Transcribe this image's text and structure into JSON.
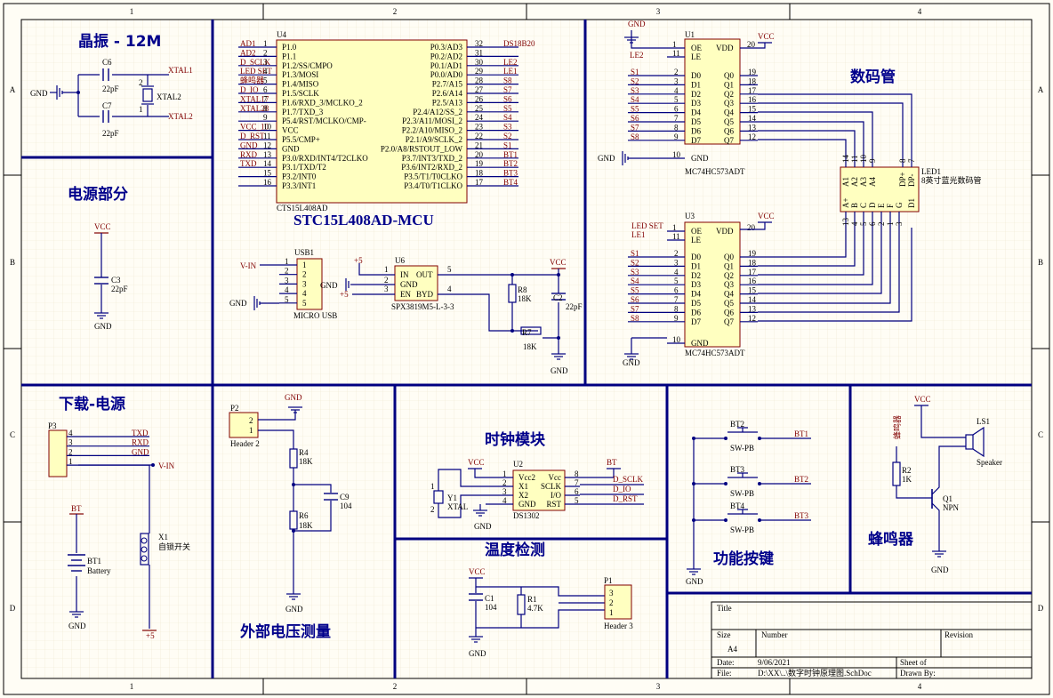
{
  "border": {
    "cols": [
      "1",
      "2",
      "3",
      "4"
    ],
    "rows": [
      "A",
      "B",
      "C",
      "D"
    ]
  },
  "sections": {
    "crystal": "晶振 - 12M",
    "power": "电源部分",
    "download": "下载-电源",
    "voltage": "外部电压测量",
    "clock": "时钟模块",
    "temp": "温度检测",
    "keys": "功能按键",
    "buzzer": "蜂鸣器",
    "display": "数码管"
  },
  "mcu": {
    "ref": "U4",
    "part": "CTS15L408AD",
    "title": "STC15L408AD-MCU",
    "left_pins": [
      {
        "net": "AD1",
        "num": "1",
        "name": "P1.0"
      },
      {
        "net": "AD2",
        "num": "2",
        "name": "P1.1"
      },
      {
        "net": "D_SCLK",
        "num": "3",
        "name": "P1.2/SS/CMPO"
      },
      {
        "net": "LED SET",
        "num": "4",
        "name": "P1.3/MOSI"
      },
      {
        "net": "蜂鸣器",
        "num": "5",
        "name": "P1.4/MISO"
      },
      {
        "net": "D_IO",
        "num": "6",
        "name": "P1.5/SCLK"
      },
      {
        "net": "XTAL17",
        "num": "7",
        "name": "P1.6/RXD_3/MCLKO_2"
      },
      {
        "net": "XTAL28",
        "num": "8",
        "name": "P1.7/TXD_3"
      },
      {
        "net": "",
        "num": "9",
        "name": "P5.4/RST/MCLKO/CMP-"
      },
      {
        "net": "VCC_10",
        "num": "10",
        "name": "VCC"
      },
      {
        "net": "D_RST",
        "num": "11",
        "name": "P5.5/CMP+"
      },
      {
        "net": "GND",
        "num": "12",
        "name": "GND"
      },
      {
        "net": "RXD",
        "num": "13",
        "name": "P3.0/RXD/INT4/T2CLKO"
      },
      {
        "net": "TXD",
        "num": "14",
        "name": "P3.1/TXD/T2"
      },
      {
        "net": "",
        "num": "15",
        "name": "P3.2/INT0"
      },
      {
        "net": "",
        "num": "16",
        "name": "P3.3/INT1"
      }
    ],
    "right_pins": [
      {
        "net": "DS18B20",
        "num": "32",
        "name": "P0.3/AD3"
      },
      {
        "net": "",
        "num": "31",
        "name": "P0.2/AD2"
      },
      {
        "net": "LE2",
        "num": "30",
        "name": "P0.1/AD1"
      },
      {
        "net": "LE1",
        "num": "29",
        "name": "P0.0/AD0"
      },
      {
        "net": "S8",
        "num": "28",
        "name": "P2.7/A15"
      },
      {
        "net": "S7",
        "num": "27",
        "name": "P2.6/A14"
      },
      {
        "net": "S6",
        "num": "26",
        "name": "P2.5/A13"
      },
      {
        "net": "S5",
        "num": "25",
        "name": "P2.4/A12/SS_2"
      },
      {
        "net": "S4",
        "num": "24",
        "name": "P2.3/A11/MOSI_2"
      },
      {
        "net": "S3",
        "num": "23",
        "name": "P2.2/A10/MISO_2"
      },
      {
        "net": "S2",
        "num": "22",
        "name": "P2.1/A9/SCLK_2"
      },
      {
        "net": "S1",
        "num": "21",
        "name": "P2.0/A8/RSTOUT_LOW"
      },
      {
        "net": "BT1",
        "num": "20",
        "name": "P3.7/INT3/TXD_2"
      },
      {
        "net": "BT2",
        "num": "19",
        "name": "P3.6/INT2/RXD_2"
      },
      {
        "net": "BT3",
        "num": "18",
        "name": "P3.5/T1/T0CLKO"
      },
      {
        "net": "BT4",
        "num": "17",
        "name": "P3.4/T0/T1CLKO"
      }
    ]
  },
  "crystal": {
    "c6": "C6",
    "c6v": "22pF",
    "c7": "C7",
    "c7v": "22pF",
    "xtal": "XTAL2",
    "gnd": "GND",
    "net1": "XTAL1",
    "net2": "XTAL2",
    "p1": "1",
    "p2": "2"
  },
  "power": {
    "vcc": "VCC",
    "ref": "C3",
    "val": "22pF",
    "gnd": "GND"
  },
  "usb": {
    "ref": "USB1",
    "part": "MICRO USB",
    "vin": "V-IN",
    "gnd": "GND",
    "pins": [
      "1",
      "2",
      "3",
      "4",
      "5"
    ]
  },
  "ldo": {
    "ref": "U6",
    "part": "SPX3819M5-L-3-3",
    "pins": [
      {
        "num": "1",
        "name": "IN"
      },
      {
        "num": "2",
        "name": "GND"
      },
      {
        "num": "3",
        "name": "EN"
      }
    ],
    "rpins": [
      {
        "num": "5",
        "name": "OUT"
      },
      {
        "num": "4",
        "name": "BYD"
      }
    ],
    "v5": "+5",
    "gnd": "GND",
    "v5b": "+5",
    "vcc": "VCC",
    "r8": "R8",
    "r8v": "18K",
    "r7": "R7",
    "r7v": "18K",
    "c2": "C2",
    "c2v": "22pF",
    "gnd2": "GND"
  },
  "latch1": {
    "ref": "U1",
    "part": "MC74HC573ADT",
    "gnd": "GND",
    "vcc": "VCC",
    "le": "LE2",
    "gnd2": "GND",
    "oe": {
      "num": "1",
      "name": "OE"
    },
    "lep": {
      "num": "11",
      "name": "LE"
    },
    "vdd": {
      "num": "20",
      "name": "VDD"
    },
    "gndp": {
      "num": "10",
      "name": "GND"
    },
    "d": [
      {
        "net": "S1",
        "num": "2",
        "name": "D0"
      },
      {
        "net": "S2",
        "num": "3",
        "name": "D1"
      },
      {
        "net": "S3",
        "num": "4",
        "name": "D2"
      },
      {
        "net": "S4",
        "num": "5",
        "name": "D3"
      },
      {
        "net": "S5",
        "num": "6",
        "name": "D4"
      },
      {
        "net": "S6",
        "num": "7",
        "name": "D5"
      },
      {
        "net": "S7",
        "num": "8",
        "name": "D6"
      },
      {
        "net": "S8",
        "num": "9",
        "name": "D7"
      }
    ],
    "q": [
      {
        "num": "19",
        "name": "Q0"
      },
      {
        "num": "18",
        "name": "Q1"
      },
      {
        "num": "17",
        "name": "Q2"
      },
      {
        "num": "16",
        "name": "Q3"
      },
      {
        "num": "15",
        "name": "Q4"
      },
      {
        "num": "14",
        "name": "Q5"
      },
      {
        "num": "13",
        "name": "Q6"
      },
      {
        "num": "12",
        "name": "Q7"
      }
    ]
  },
  "latch2": {
    "ref": "U3",
    "part": "MC74HC573ADT",
    "vcc": "VCC",
    "gnd": "GND",
    "ledset": "LED SET",
    "le": "LE1",
    "oe": {
      "num": "1",
      "name": "OE"
    },
    "lep": {
      "num": "11",
      "name": "LE"
    },
    "vdd": {
      "num": "20",
      "name": "VDD"
    },
    "gndp": {
      "num": "10",
      "name": "GND"
    },
    "d": [
      {
        "net": "S1",
        "num": "2",
        "name": "D0"
      },
      {
        "net": "S2",
        "num": "3",
        "name": "D1"
      },
      {
        "net": "S3",
        "num": "4",
        "name": "D2"
      },
      {
        "net": "S4",
        "num": "5",
        "name": "D3"
      },
      {
        "net": "S5",
        "num": "6",
        "name": "D4"
      },
      {
        "net": "S6",
        "num": "7",
        "name": "D5"
      },
      {
        "net": "S7",
        "num": "8",
        "name": "D6"
      },
      {
        "net": "S8",
        "num": "9",
        "name": "D7"
      }
    ],
    "q": [
      {
        "num": "19",
        "name": "Q0"
      },
      {
        "num": "18",
        "name": "Q1"
      },
      {
        "num": "17",
        "name": "Q2"
      },
      {
        "num": "16",
        "name": "Q3"
      },
      {
        "num": "15",
        "name": "Q4"
      },
      {
        "num": "14",
        "name": "Q5"
      },
      {
        "num": "13",
        "name": "Q6"
      },
      {
        "num": "12",
        "name": "Q7"
      }
    ]
  },
  "led": {
    "ref": "LED1",
    "part": "8英寸蓝光数码管",
    "top_nums": [
      "14",
      "11",
      "10",
      "9",
      "8",
      "7"
    ],
    "top_names": [
      "A1",
      "A2",
      "A3",
      "A4",
      "DP+",
      "DP-"
    ],
    "bottom_nums": [
      "13",
      "4",
      "5",
      "6",
      "2",
      "1",
      "3"
    ],
    "bottom_names": [
      "A+",
      "B",
      "C",
      "D",
      "E",
      "F",
      "G",
      "D1"
    ]
  },
  "download": {
    "ref": "P3",
    "nets": [
      "TXD",
      "RXD",
      "GND",
      ""
    ],
    "pins": [
      "4",
      "3",
      "2",
      "1"
    ],
    "vin": "V-IN",
    "bt": "BT",
    "bt1": "BT1",
    "bt1v": "Battery",
    "x1": "X1",
    "x1v": "自锁开关",
    "gnd": "GND",
    "v5": "+5"
  },
  "voltage": {
    "ref": "P2",
    "part": "Header 2",
    "pins": [
      "2",
      "1"
    ],
    "gnd": "GND",
    "r4": "R4",
    "r4v": "18K",
    "r6": "R6",
    "r6v": "18K",
    "c9": "C9",
    "c9v": "104",
    "gnd2": "GND"
  },
  "clock": {
    "ref": "U2",
    "part": "DS1302",
    "vcc": "VCC",
    "bt": "BT",
    "y1": "Y1",
    "y1v": "XTAL",
    "gnd": "GND",
    "lpins": [
      {
        "num": "1",
        "name": "Vcc2"
      },
      {
        "num": "2",
        "name": "X1"
      },
      {
        "num": "3",
        "name": "X2"
      },
      {
        "num": "4",
        "name": "GND"
      }
    ],
    "rpins": [
      {
        "num": "8",
        "name": "Vcc"
      },
      {
        "num": "7",
        "name": "SCLK"
      },
      {
        "num": "6",
        "name": "I/O"
      },
      {
        "num": "5",
        "name": "RST"
      }
    ],
    "nets": [
      "D_SCLK",
      "D_IO",
      "D_RST"
    ],
    "yp": [
      "1",
      "2"
    ]
  },
  "temp": {
    "vcc": "VCC",
    "c1": "C1",
    "c1v": "104",
    "r1": "R1",
    "r1v": "4.7K",
    "p1": "P1",
    "part": "Header 3",
    "pins": [
      "3",
      "2",
      "1"
    ],
    "gnd": "GND"
  },
  "keys": {
    "items": [
      {
        "ref": "BT2",
        "part": "SW-PB",
        "net": "BT1"
      },
      {
        "ref": "BT3",
        "part": "SW-PB",
        "net": "BT2"
      },
      {
        "ref": "BT4",
        "part": "SW-PB",
        "net": "BT3"
      }
    ],
    "gnd": "GND"
  },
  "buzzer": {
    "vcc": "VCC",
    "ls": "LS1",
    "lsv": "Speaker",
    "net": "蜂鸣器",
    "r2": "R2",
    "r2v": "1K",
    "q1": "Q1",
    "q1v": "NPN",
    "gnd": "GND"
  },
  "titleblock": {
    "title": "Title",
    "size": "Size",
    "sizev": "A4",
    "number": "Number",
    "revision": "Revision",
    "date": "Date:",
    "datev": "9/06/2021",
    "file": "File:",
    "filev": "D:\\XX\\..\\数字时钟原理图.SchDoc",
    "sheet": "Sheet of",
    "drawn": "Drawn By:"
  }
}
